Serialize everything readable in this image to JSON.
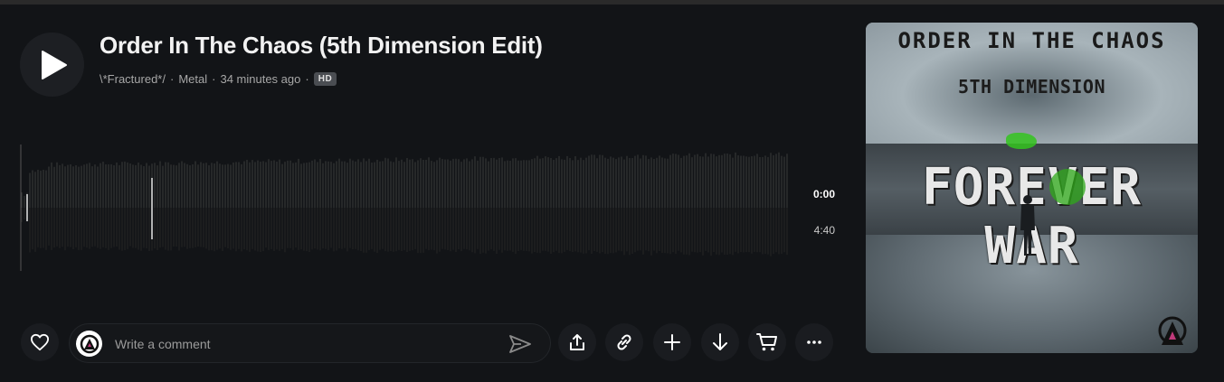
{
  "track": {
    "title": "Order In The Chaos (5th Dimension Edit)",
    "artist": "\\*Fractured*/",
    "genre": "Metal",
    "posted": "34 minutes ago",
    "quality_badge": "HD",
    "separator": "·"
  },
  "player": {
    "current_time": "0:00",
    "total_time": "4:40",
    "progress": 0
  },
  "comment": {
    "placeholder": "Write a comment"
  },
  "actions": {
    "like": "heart-icon",
    "share": "share-icon",
    "copy_link": "link-icon",
    "add_to_playlist": "plus-icon",
    "download": "download-icon",
    "buy": "cart-icon",
    "more": "more-icon"
  },
  "artwork": {
    "line1": "ORDER IN THE CHAOS",
    "line2": "5TH DIMENSION",
    "line3": "FOREVER WAR"
  },
  "colors": {
    "background": "#121417",
    "text_primary": "#f2f2f2",
    "text_secondary": "#a7a7a7",
    "waveform": "#3a3a3a"
  }
}
